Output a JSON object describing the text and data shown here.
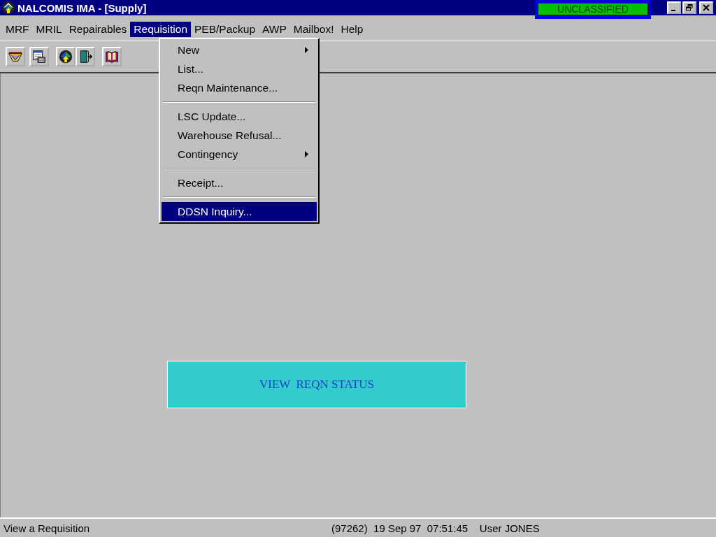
{
  "window": {
    "title": "NALCOMIS IMA - [Supply]",
    "classification": "UNCLASSIFIED"
  },
  "menu_bar": [
    {
      "label": "MRF",
      "selected": false
    },
    {
      "label": "MRIL",
      "selected": false
    },
    {
      "label": "Repairables",
      "selected": false
    },
    {
      "label": "Requisition",
      "selected": true
    },
    {
      "label": "PEB/Packup",
      "selected": false
    },
    {
      "label": "AWP",
      "selected": false
    },
    {
      "label": "Mailbox!",
      "selected": false
    },
    {
      "label": "Help",
      "selected": false
    }
  ],
  "toolbar": [
    {
      "kind": "tray"
    },
    {
      "kind": "calendar"
    },
    {
      "kind": "logo"
    },
    {
      "kind": "door"
    },
    {
      "kind": "book"
    }
  ],
  "dropdown": {
    "groups": [
      [
        {
          "label": "New",
          "submenu": true,
          "selected": false
        },
        {
          "label": "List...",
          "submenu": false,
          "selected": false
        },
        {
          "label": "Reqn Maintenance...",
          "submenu": false,
          "selected": false
        }
      ],
      [
        {
          "label": "LSC Update...",
          "submenu": false,
          "selected": false
        },
        {
          "label": "Warehouse Refusal...",
          "submenu": false,
          "selected": false
        },
        {
          "label": "Contingency",
          "submenu": true,
          "selected": false
        }
      ],
      [
        {
          "label": "Receipt...",
          "submenu": false,
          "selected": false
        }
      ],
      [
        {
          "label": "DDSN Inquiry...",
          "submenu": false,
          "selected": true
        }
      ]
    ]
  },
  "callout": "VIEW  REQN STATUS",
  "status_bar": {
    "message": "View a Requisition",
    "info": "(97262)  19 Sep 97  07:51:45    User JONES"
  }
}
